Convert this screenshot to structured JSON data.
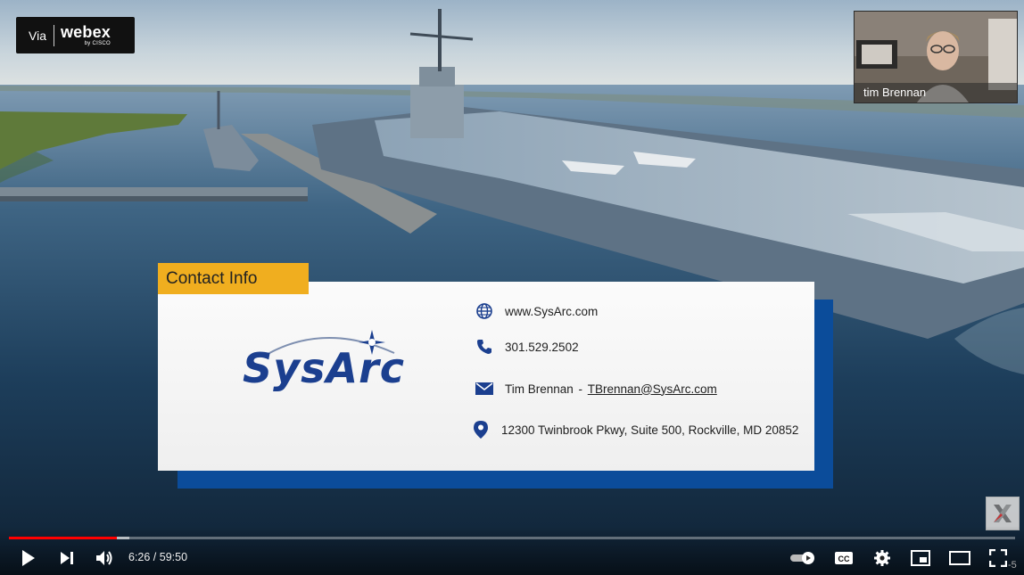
{
  "overlay": {
    "via_label": "Via",
    "brand_label": "webex",
    "brand_sub": "by CISCO"
  },
  "participant": {
    "name": "tim Brennan"
  },
  "slide": {
    "tab_title": "Contact Info",
    "logo_text": "SysArc",
    "website": "www.SysArc.com",
    "phone": "301.529.2502",
    "email_name": "Tim Brennan",
    "email_sep": " - ",
    "email": "TBrennan@SysArc.com",
    "address": "12300 Twinbrook Pkwy, Suite 500, Rockville, MD 20852"
  },
  "player": {
    "current_time": "6:26",
    "duration": "59:50",
    "time_display": "6:26 / 59:50",
    "played_fraction": 0.1075,
    "buffered_fraction": 0.12,
    "corner_text": "-5",
    "colors": {
      "progress_played": "#ff0000",
      "tab_accent": "#f0ae1f",
      "card_shadow": "#0b4c9a",
      "logo_blue": "#1b3f8f"
    },
    "icons": [
      "play-icon",
      "next-icon",
      "volume-icon",
      "autoplay-toggle-icon",
      "captions-icon",
      "settings-icon",
      "miniplayer-icon",
      "theater-icon",
      "fullscreen-icon"
    ]
  }
}
